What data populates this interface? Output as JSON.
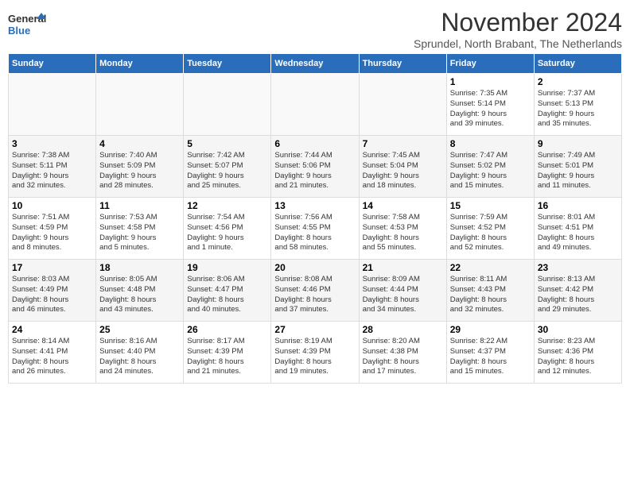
{
  "header": {
    "logo_general": "General",
    "logo_blue": "Blue",
    "month_title": "November 2024",
    "subtitle": "Sprundel, North Brabant, The Netherlands"
  },
  "weekdays": [
    "Sunday",
    "Monday",
    "Tuesday",
    "Wednesday",
    "Thursday",
    "Friday",
    "Saturday"
  ],
  "weeks": [
    [
      {
        "day": "",
        "info": ""
      },
      {
        "day": "",
        "info": ""
      },
      {
        "day": "",
        "info": ""
      },
      {
        "day": "",
        "info": ""
      },
      {
        "day": "",
        "info": ""
      },
      {
        "day": "1",
        "info": "Sunrise: 7:35 AM\nSunset: 5:14 PM\nDaylight: 9 hours\nand 39 minutes."
      },
      {
        "day": "2",
        "info": "Sunrise: 7:37 AM\nSunset: 5:13 PM\nDaylight: 9 hours\nand 35 minutes."
      }
    ],
    [
      {
        "day": "3",
        "info": "Sunrise: 7:38 AM\nSunset: 5:11 PM\nDaylight: 9 hours\nand 32 minutes."
      },
      {
        "day": "4",
        "info": "Sunrise: 7:40 AM\nSunset: 5:09 PM\nDaylight: 9 hours\nand 28 minutes."
      },
      {
        "day": "5",
        "info": "Sunrise: 7:42 AM\nSunset: 5:07 PM\nDaylight: 9 hours\nand 25 minutes."
      },
      {
        "day": "6",
        "info": "Sunrise: 7:44 AM\nSunset: 5:06 PM\nDaylight: 9 hours\nand 21 minutes."
      },
      {
        "day": "7",
        "info": "Sunrise: 7:45 AM\nSunset: 5:04 PM\nDaylight: 9 hours\nand 18 minutes."
      },
      {
        "day": "8",
        "info": "Sunrise: 7:47 AM\nSunset: 5:02 PM\nDaylight: 9 hours\nand 15 minutes."
      },
      {
        "day": "9",
        "info": "Sunrise: 7:49 AM\nSunset: 5:01 PM\nDaylight: 9 hours\nand 11 minutes."
      }
    ],
    [
      {
        "day": "10",
        "info": "Sunrise: 7:51 AM\nSunset: 4:59 PM\nDaylight: 9 hours\nand 8 minutes."
      },
      {
        "day": "11",
        "info": "Sunrise: 7:53 AM\nSunset: 4:58 PM\nDaylight: 9 hours\nand 5 minutes."
      },
      {
        "day": "12",
        "info": "Sunrise: 7:54 AM\nSunset: 4:56 PM\nDaylight: 9 hours\nand 1 minute."
      },
      {
        "day": "13",
        "info": "Sunrise: 7:56 AM\nSunset: 4:55 PM\nDaylight: 8 hours\nand 58 minutes."
      },
      {
        "day": "14",
        "info": "Sunrise: 7:58 AM\nSunset: 4:53 PM\nDaylight: 8 hours\nand 55 minutes."
      },
      {
        "day": "15",
        "info": "Sunrise: 7:59 AM\nSunset: 4:52 PM\nDaylight: 8 hours\nand 52 minutes."
      },
      {
        "day": "16",
        "info": "Sunrise: 8:01 AM\nSunset: 4:51 PM\nDaylight: 8 hours\nand 49 minutes."
      }
    ],
    [
      {
        "day": "17",
        "info": "Sunrise: 8:03 AM\nSunset: 4:49 PM\nDaylight: 8 hours\nand 46 minutes."
      },
      {
        "day": "18",
        "info": "Sunrise: 8:05 AM\nSunset: 4:48 PM\nDaylight: 8 hours\nand 43 minutes."
      },
      {
        "day": "19",
        "info": "Sunrise: 8:06 AM\nSunset: 4:47 PM\nDaylight: 8 hours\nand 40 minutes."
      },
      {
        "day": "20",
        "info": "Sunrise: 8:08 AM\nSunset: 4:46 PM\nDaylight: 8 hours\nand 37 minutes."
      },
      {
        "day": "21",
        "info": "Sunrise: 8:09 AM\nSunset: 4:44 PM\nDaylight: 8 hours\nand 34 minutes."
      },
      {
        "day": "22",
        "info": "Sunrise: 8:11 AM\nSunset: 4:43 PM\nDaylight: 8 hours\nand 32 minutes."
      },
      {
        "day": "23",
        "info": "Sunrise: 8:13 AM\nSunset: 4:42 PM\nDaylight: 8 hours\nand 29 minutes."
      }
    ],
    [
      {
        "day": "24",
        "info": "Sunrise: 8:14 AM\nSunset: 4:41 PM\nDaylight: 8 hours\nand 26 minutes."
      },
      {
        "day": "25",
        "info": "Sunrise: 8:16 AM\nSunset: 4:40 PM\nDaylight: 8 hours\nand 24 minutes."
      },
      {
        "day": "26",
        "info": "Sunrise: 8:17 AM\nSunset: 4:39 PM\nDaylight: 8 hours\nand 21 minutes."
      },
      {
        "day": "27",
        "info": "Sunrise: 8:19 AM\nSunset: 4:39 PM\nDaylight: 8 hours\nand 19 minutes."
      },
      {
        "day": "28",
        "info": "Sunrise: 8:20 AM\nSunset: 4:38 PM\nDaylight: 8 hours\nand 17 minutes."
      },
      {
        "day": "29",
        "info": "Sunrise: 8:22 AM\nSunset: 4:37 PM\nDaylight: 8 hours\nand 15 minutes."
      },
      {
        "day": "30",
        "info": "Sunrise: 8:23 AM\nSunset: 4:36 PM\nDaylight: 8 hours\nand 12 minutes."
      }
    ]
  ]
}
